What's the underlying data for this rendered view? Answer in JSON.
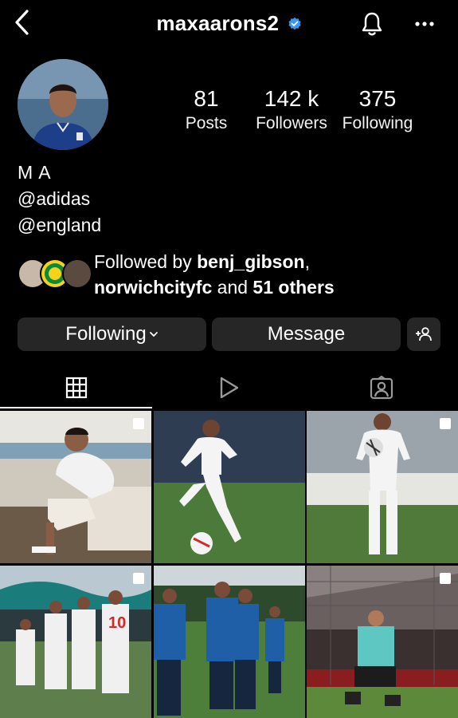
{
  "header": {
    "username": "maxaarons2",
    "icons": [
      "back-arrow-icon",
      "verified-badge-icon",
      "bell-icon",
      "more-icon"
    ]
  },
  "stats": [
    {
      "value": "81",
      "label": "Posts"
    },
    {
      "value": "142 k",
      "label": "Followers"
    },
    {
      "value": "375",
      "label": "Following"
    }
  ],
  "bio": {
    "name": "M A",
    "lines": [
      "@adidas",
      "@england"
    ]
  },
  "followed_by": {
    "prefix": "Followed by ",
    "user1": "benj_gibson",
    "sep": ",",
    "user2": "norwichcityfc",
    "middle": " and ",
    "others": "51 others"
  },
  "actions": {
    "following_label": "Following",
    "message_label": "Message",
    "suggest_icon": "add-person-icon"
  },
  "tabs": [
    {
      "name": "posts",
      "icon": "grid-icon",
      "active": true
    },
    {
      "name": "reels",
      "icon": "play-icon",
      "active": false
    },
    {
      "name": "tagged",
      "icon": "tagged-person-icon",
      "active": false
    }
  ],
  "grid_posts": [
    {
      "index": 1,
      "multi": true
    },
    {
      "index": 2,
      "multi": false
    },
    {
      "index": 3,
      "multi": true
    },
    {
      "index": 4,
      "multi": true
    },
    {
      "index": 5,
      "multi": false
    },
    {
      "index": 6,
      "multi": true
    }
  ],
  "colors": {
    "background": "#000000",
    "button_bg": "#262626",
    "verified_blue": "#3897f0",
    "text": "#ffffff"
  }
}
